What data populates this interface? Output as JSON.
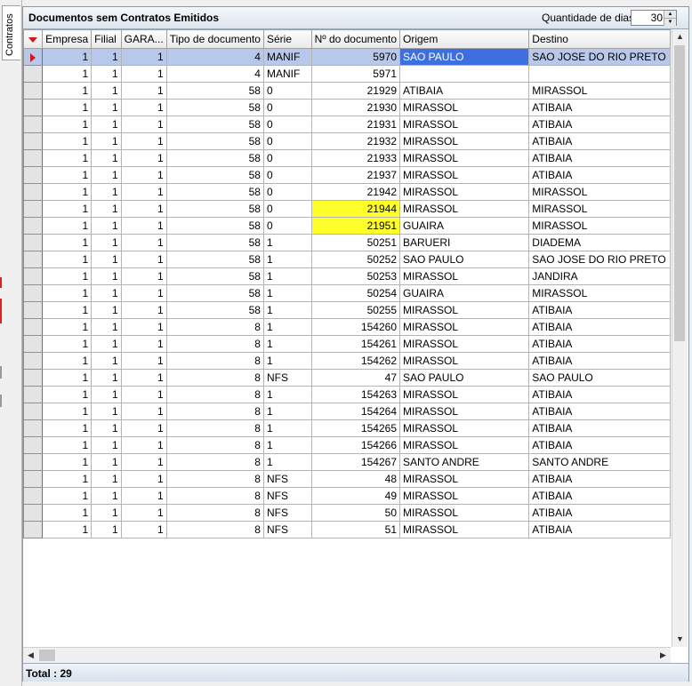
{
  "sidebar": {
    "tab_label": "Contratos"
  },
  "header": {
    "title": "Documentos sem Contratos Emitidos",
    "dias_label": "Quantidade de dias",
    "dias_value": "30"
  },
  "columns": [
    "Empresa",
    "Filial",
    "GARA...",
    "Tipo de documento",
    "Série",
    "Nº do documento",
    "Origem",
    "Destino"
  ],
  "rows": [
    [
      "1",
      "1",
      "1",
      "4",
      "MANIF",
      "5970",
      "SAO PAULO",
      "SAO JOSE DO RIO PRETO"
    ],
    [
      "1",
      "1",
      "1",
      "4",
      "MANIF",
      "5971",
      "",
      ""
    ],
    [
      "1",
      "1",
      "1",
      "58",
      "0",
      "21929",
      "ATIBAIA",
      "MIRASSOL"
    ],
    [
      "1",
      "1",
      "1",
      "58",
      "0",
      "21930",
      "MIRASSOL",
      "ATIBAIA"
    ],
    [
      "1",
      "1",
      "1",
      "58",
      "0",
      "21931",
      "MIRASSOL",
      "ATIBAIA"
    ],
    [
      "1",
      "1",
      "1",
      "58",
      "0",
      "21932",
      "MIRASSOL",
      "ATIBAIA"
    ],
    [
      "1",
      "1",
      "1",
      "58",
      "0",
      "21933",
      "MIRASSOL",
      "ATIBAIA"
    ],
    [
      "1",
      "1",
      "1",
      "58",
      "0",
      "21937",
      "MIRASSOL",
      "ATIBAIA"
    ],
    [
      "1",
      "1",
      "1",
      "58",
      "0",
      "21942",
      "MIRASSOL",
      "MIRASSOL"
    ],
    [
      "1",
      "1",
      "1",
      "58",
      "0",
      "21944",
      "MIRASSOL",
      "MIRASSOL"
    ],
    [
      "1",
      "1",
      "1",
      "58",
      "0",
      "21951",
      "GUAIRA",
      "MIRASSOL"
    ],
    [
      "1",
      "1",
      "1",
      "58",
      "1",
      "50251",
      "BARUERI",
      "DIADEMA"
    ],
    [
      "1",
      "1",
      "1",
      "58",
      "1",
      "50252",
      "SAO PAULO",
      "SAO JOSE DO RIO PRETO"
    ],
    [
      "1",
      "1",
      "1",
      "58",
      "1",
      "50253",
      "MIRASSOL",
      "JANDIRA"
    ],
    [
      "1",
      "1",
      "1",
      "58",
      "1",
      "50254",
      "GUAIRA",
      "MIRASSOL"
    ],
    [
      "1",
      "1",
      "1",
      "58",
      "1",
      "50255",
      "MIRASSOL",
      "ATIBAIA"
    ],
    [
      "1",
      "1",
      "1",
      "8",
      "1",
      "154260",
      "MIRASSOL",
      "ATIBAIA"
    ],
    [
      "1",
      "1",
      "1",
      "8",
      "1",
      "154261",
      "MIRASSOL",
      "ATIBAIA"
    ],
    [
      "1",
      "1",
      "1",
      "8",
      "1",
      "154262",
      "MIRASSOL",
      "ATIBAIA"
    ],
    [
      "1",
      "1",
      "1",
      "8",
      "NFS",
      "47",
      "SAO PAULO",
      "SAO PAULO"
    ],
    [
      "1",
      "1",
      "1",
      "8",
      "1",
      "154263",
      "MIRASSOL",
      "ATIBAIA"
    ],
    [
      "1",
      "1",
      "1",
      "8",
      "1",
      "154264",
      "MIRASSOL",
      "ATIBAIA"
    ],
    [
      "1",
      "1",
      "1",
      "8",
      "1",
      "154265",
      "MIRASSOL",
      "ATIBAIA"
    ],
    [
      "1",
      "1",
      "1",
      "8",
      "1",
      "154266",
      "MIRASSOL",
      "ATIBAIA"
    ],
    [
      "1",
      "1",
      "1",
      "8",
      "1",
      "154267",
      "SANTO ANDRE",
      "SANTO ANDRE"
    ],
    [
      "1",
      "1",
      "1",
      "8",
      "NFS",
      "48",
      "MIRASSOL",
      "ATIBAIA"
    ],
    [
      "1",
      "1",
      "1",
      "8",
      "NFS",
      "49",
      "MIRASSOL",
      "ATIBAIA"
    ],
    [
      "1",
      "1",
      "1",
      "8",
      "NFS",
      "50",
      "MIRASSOL",
      "ATIBAIA"
    ],
    [
      "1",
      "1",
      "1",
      "8",
      "NFS",
      "51",
      "MIRASSOL",
      "ATIBAIA"
    ]
  ],
  "selected_row": 0,
  "highlighted_rows": [
    9,
    10
  ],
  "highlight_color": "#ffff2a",
  "footer": {
    "total_label": "Total : 29"
  }
}
